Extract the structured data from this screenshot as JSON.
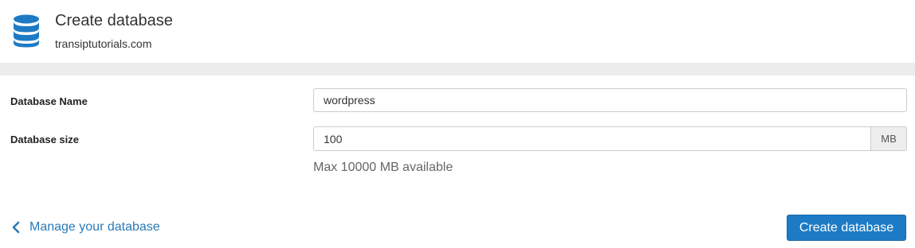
{
  "header": {
    "icon": "database-icon",
    "title": "Create database",
    "subtitle": "transiptutorials.com"
  },
  "form": {
    "name_label": "Database Name",
    "name_value": "wordpress",
    "size_label": "Database size",
    "size_value": "100",
    "size_unit": "MB",
    "size_help": "Max 10000 MB available"
  },
  "footer": {
    "back_icon": "chevron-left-icon",
    "back_label": "Manage your database",
    "submit_label": "Create database"
  },
  "colors": {
    "accent": "#1d7bc5",
    "link": "#2a7ab8",
    "band": "#ececec"
  }
}
